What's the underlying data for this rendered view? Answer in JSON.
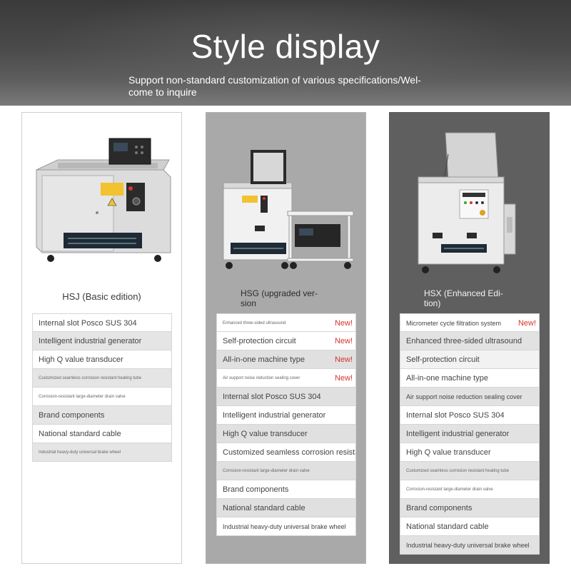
{
  "header": {
    "title": "Style display",
    "subtitle": "Support non-standard customization of various specifications/Wel-come to inquire"
  },
  "colors": {
    "new_badge": "#d9342b",
    "banner_dark": "#3a3a3a",
    "panel_2_bg": "#a9a9a9",
    "panel_3_bg": "#5f5f5f"
  },
  "panels": [
    {
      "title": "HSJ (Basic edition)",
      "features": [
        {
          "label": "Internal slot Posco SUS 304",
          "new": ""
        },
        {
          "label": "Intelligent industrial generator",
          "new": ""
        },
        {
          "label": "High Q value transducer",
          "new": ""
        },
        {
          "label": "Customized seamless corrosion resistant heating tube",
          "new": ""
        },
        {
          "label": "Corrosion-resistant large-diameter drain valve",
          "new": ""
        },
        {
          "label": "Brand components",
          "new": ""
        },
        {
          "label": "National standard cable",
          "new": ""
        },
        {
          "label": "Industrial heavy-duty universal brake wheel",
          "new": ""
        }
      ]
    },
    {
      "title": "HSG (upgraded ver-sion",
      "features": [
        {
          "label": "Enhanced three-sided ultrasound",
          "new": "New!"
        },
        {
          "label": "Self-protection circuit",
          "new": "New!"
        },
        {
          "label": "All-in-one machine type",
          "new": "New!"
        },
        {
          "label": "Air support noise reduction sealing cover",
          "new": "New!"
        },
        {
          "label": "Internal slot Posco SUS 304",
          "new": ""
        },
        {
          "label": "Intelligent industrial generator",
          "new": ""
        },
        {
          "label": "High Q value transducer",
          "new": ""
        },
        {
          "label": "Customized seamless corrosion resistan",
          "new": ""
        },
        {
          "label": "Corrosion-resistant large-diameter drain valve",
          "new": ""
        },
        {
          "label": "Brand components",
          "new": ""
        },
        {
          "label": "National standard cable",
          "new": ""
        },
        {
          "label": "Industrial heavy-duty universal brake wheel",
          "new": ""
        }
      ]
    },
    {
      "title": "HSX (Enhanced Edi-tion)",
      "features": [
        {
          "label": "Micrometer cycle filtration system",
          "new": "New!"
        },
        {
          "label": "Enhanced three-sided ultrasound",
          "new": ""
        },
        {
          "label": "Self-protection circuit",
          "new": ""
        },
        {
          "label": "All-in-one machine type",
          "new": ""
        },
        {
          "label": "Air support noise reduction sealing cover",
          "new": ""
        },
        {
          "label": "Internal slot Posco SUS 304",
          "new": ""
        },
        {
          "label": "Intelligent industrial generator",
          "new": ""
        },
        {
          "label": "High Q value transducer",
          "new": ""
        },
        {
          "label": "Customized seamless corrosion resistant heating tube",
          "new": ""
        },
        {
          "label": "Corrosion-resistant large-diameter drain valve",
          "new": ""
        },
        {
          "label": "Brand components",
          "new": ""
        },
        {
          "label": "National standard cable",
          "new": ""
        },
        {
          "label": "Industrial heavy-duty universal brake wheel",
          "new": ""
        }
      ]
    }
  ]
}
